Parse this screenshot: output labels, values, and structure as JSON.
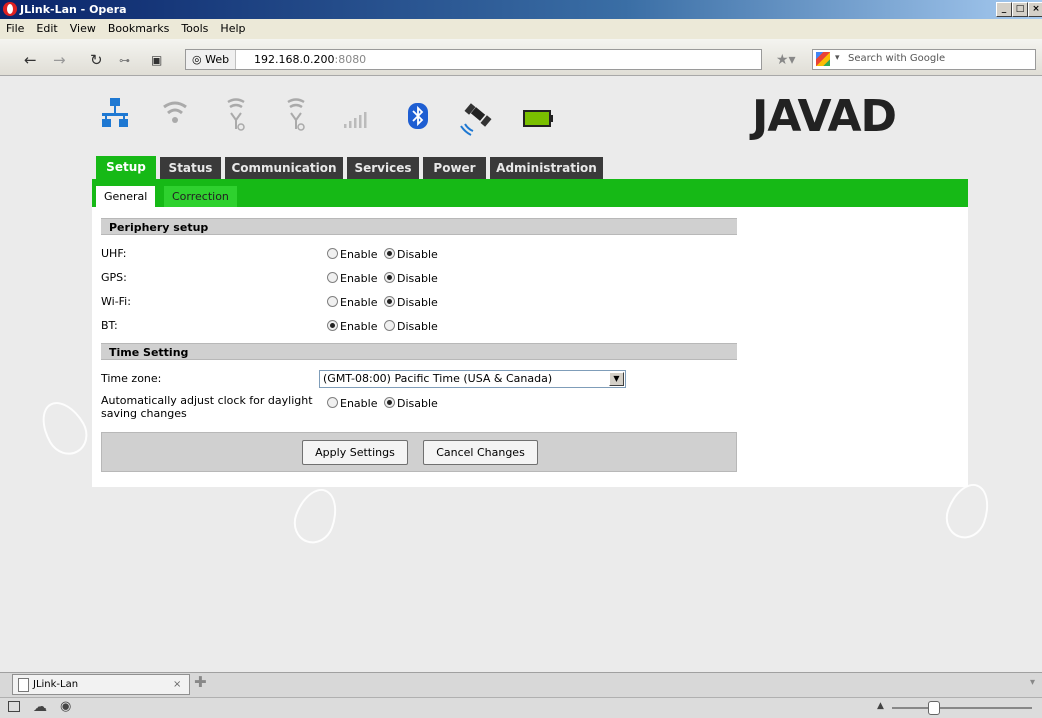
{
  "window": {
    "title": "JLink-Lan - Opera"
  },
  "menu": [
    "File",
    "Edit",
    "View",
    "Bookmarks",
    "Tools",
    "Help"
  ],
  "address": {
    "chip_label": "Web",
    "url_host": "192.168.0.200",
    "url_port": ":8080"
  },
  "search": {
    "placeholder": "Search with Google"
  },
  "logo": {
    "text": "JAVAD"
  },
  "status_icons": [
    "network-icon",
    "wifi-icon",
    "antenna-icon",
    "antenna-2-icon",
    "signal-bars-icon",
    "bluetooth-icon",
    "satellite-icon",
    "battery-icon"
  ],
  "colors": {
    "tab_active": "#16b916",
    "tab_inactive": "#3a3a3a",
    "battery": "#7ac000"
  },
  "tabs": [
    "Setup",
    "Status",
    "Communication",
    "Services",
    "Power",
    "Administration"
  ],
  "subtabs": [
    "General",
    "Correction"
  ],
  "periphery": {
    "title": "Periphery setup",
    "rows": [
      {
        "label": "UHF:",
        "enable": "Enable",
        "disable": "Disable",
        "selected": "Disable"
      },
      {
        "label": "GPS:",
        "enable": "Enable",
        "disable": "Disable",
        "selected": "Disable"
      },
      {
        "label": "Wi-Fi:",
        "enable": "Enable",
        "disable": "Disable",
        "selected": "Disable"
      },
      {
        "label": "BT:",
        "enable": "Enable",
        "disable": "Disable",
        "selected": "Enable"
      }
    ]
  },
  "time": {
    "title": "Time Setting",
    "tz_label": "Time zone:",
    "tz_value": "(GMT-08:00) Pacific Time (USA & Canada)",
    "dst_label_1": "Automatically adjust clock for daylight",
    "dst_label_2": "saving changes",
    "dst_enable": "Enable",
    "dst_disable": "Disable",
    "dst_selected": "Disable"
  },
  "buttons": {
    "apply": "Apply Settings",
    "cancel": "Cancel Changes"
  },
  "browser_tab": {
    "label": "JLink-Lan"
  }
}
